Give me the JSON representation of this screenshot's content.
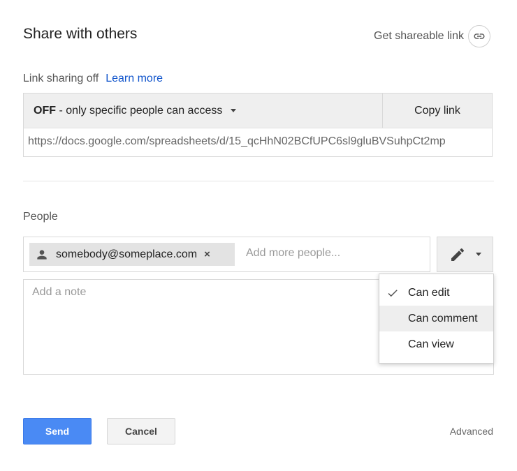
{
  "dialog": {
    "title": "Share with others",
    "get_shareable_link": "Get shareable link"
  },
  "link_sharing": {
    "status": "Link sharing off",
    "learn_more": "Learn more",
    "access_off": "OFF",
    "access_desc": " - only specific people can access",
    "copy_link": "Copy link",
    "url": "https://docs.google.com/spreadsheets/d/15_qcHhN02BCfUPC6sl9gluBVSuhpCt2mp"
  },
  "people": {
    "label": "People",
    "chip_email": "somebody@someplace.com",
    "chip_remove": "×",
    "add_placeholder": "Add more people...",
    "note_placeholder": "Add a note"
  },
  "permission_menu": {
    "items": [
      {
        "label": "Can edit",
        "checked": true
      },
      {
        "label": "Can comment",
        "highlighted": true
      },
      {
        "label": "Can view"
      }
    ]
  },
  "footer": {
    "send": "Send",
    "cancel": "Cancel",
    "advanced": "Advanced"
  },
  "colors": {
    "accent": "#4a8af4",
    "link": "#15c"
  }
}
